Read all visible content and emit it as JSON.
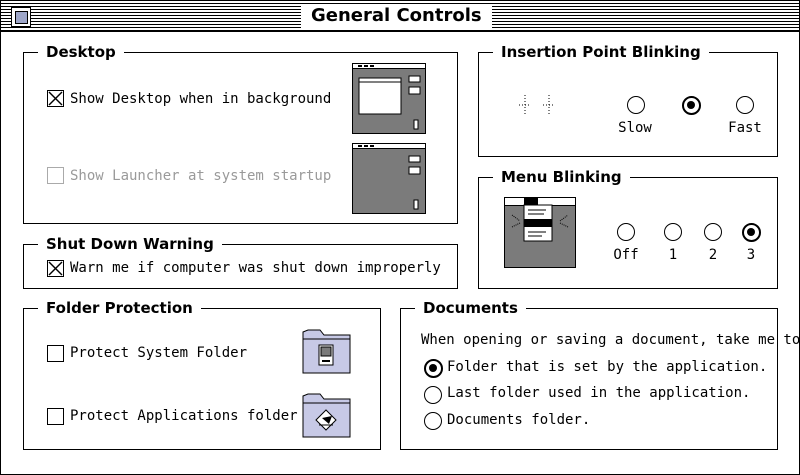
{
  "window": {
    "title": "General Controls"
  },
  "desktop": {
    "title": "Desktop",
    "show_desktop": {
      "label": "Show Desktop when in background",
      "checked": true
    },
    "show_launcher": {
      "label": "Show Launcher at system startup",
      "checked": false,
      "enabled": false
    }
  },
  "insertion_point": {
    "title": "Insertion Point Blinking",
    "options": [
      "Slow",
      "",
      "Fast"
    ],
    "selected": 1
  },
  "menu_blinking": {
    "title": "Menu Blinking",
    "options": [
      "Off",
      "1",
      "2",
      "3"
    ],
    "selected": 3
  },
  "shutdown": {
    "title": "Shut Down Warning",
    "warn": {
      "label": "Warn me if computer was shut down improperly",
      "checked": true
    }
  },
  "folder_protection": {
    "title": "Folder Protection",
    "system": {
      "label": "Protect System Folder",
      "checked": false
    },
    "apps": {
      "label": "Protect Applications folder",
      "checked": false
    }
  },
  "documents": {
    "title": "Documents",
    "prompt": "When opening or saving a document, take me to",
    "options": [
      "Folder that is set by the application.",
      "Last folder used in the application.",
      "Documents folder."
    ],
    "selected": 0
  },
  "colors": {
    "desktop_gray": "#7b7b7b",
    "folder_fill": "#c7c9e6"
  }
}
